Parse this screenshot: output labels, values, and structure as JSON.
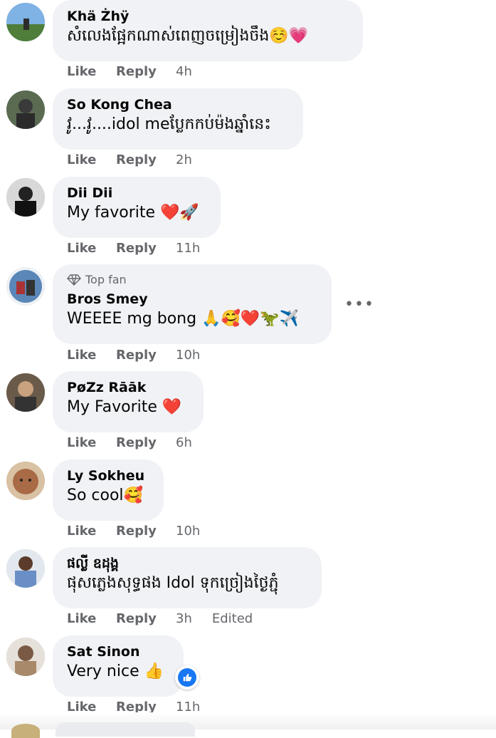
{
  "comments": [
    {
      "name": "Khä Żhÿ",
      "text": "សំលេងផ្អែកណាស់ពេញចម្រៀងចឹង☺️💗",
      "like": "Like",
      "reply": "Reply",
      "time": "4h"
    },
    {
      "name": "So Kong Chea",
      "text": "វូ...វូ....idol meប្លែកកប់ម៉ងឆ្នាំនេះ",
      "like": "Like",
      "reply": "Reply",
      "time": "2h"
    },
    {
      "name": "Dii Dii",
      "text": "My favorite ❤️🚀",
      "like": "Like",
      "reply": "Reply",
      "time": "11h"
    },
    {
      "badge": "Top fan",
      "name": "Bros Smey",
      "text": "WEEEE mg bong 🙏🥰❤️🦖✈️",
      "like": "Like",
      "reply": "Reply",
      "time": "10h",
      "more": "•••"
    },
    {
      "name": "PøZz Rāāk",
      "text": "My Favorite ❤️",
      "like": "Like",
      "reply": "Reply",
      "time": "6h"
    },
    {
      "name": "Ly Sokheu",
      "text": "So cool🥰",
      "like": "Like",
      "reply": "Reply",
      "time": "10h"
    },
    {
      "name": "ផល្លី ឧដុង្គ",
      "text": "ផុសភ្លេងសុទ្ធផង Idol ទុកច្រៀងថ្ងៃភ្ជុំ",
      "like": "Like",
      "reply": "Reply",
      "time": "3h",
      "edited": "Edited"
    },
    {
      "name": "Sat Sinon",
      "text": "Very nice 👍",
      "like": "Like",
      "reply": "Reply",
      "time": "11h",
      "reaction_icon": "like-reaction-icon"
    }
  ],
  "colors": {
    "bubble": "#f0f2f5",
    "meta": "#65676b",
    "like_blue": "#1877f2"
  }
}
